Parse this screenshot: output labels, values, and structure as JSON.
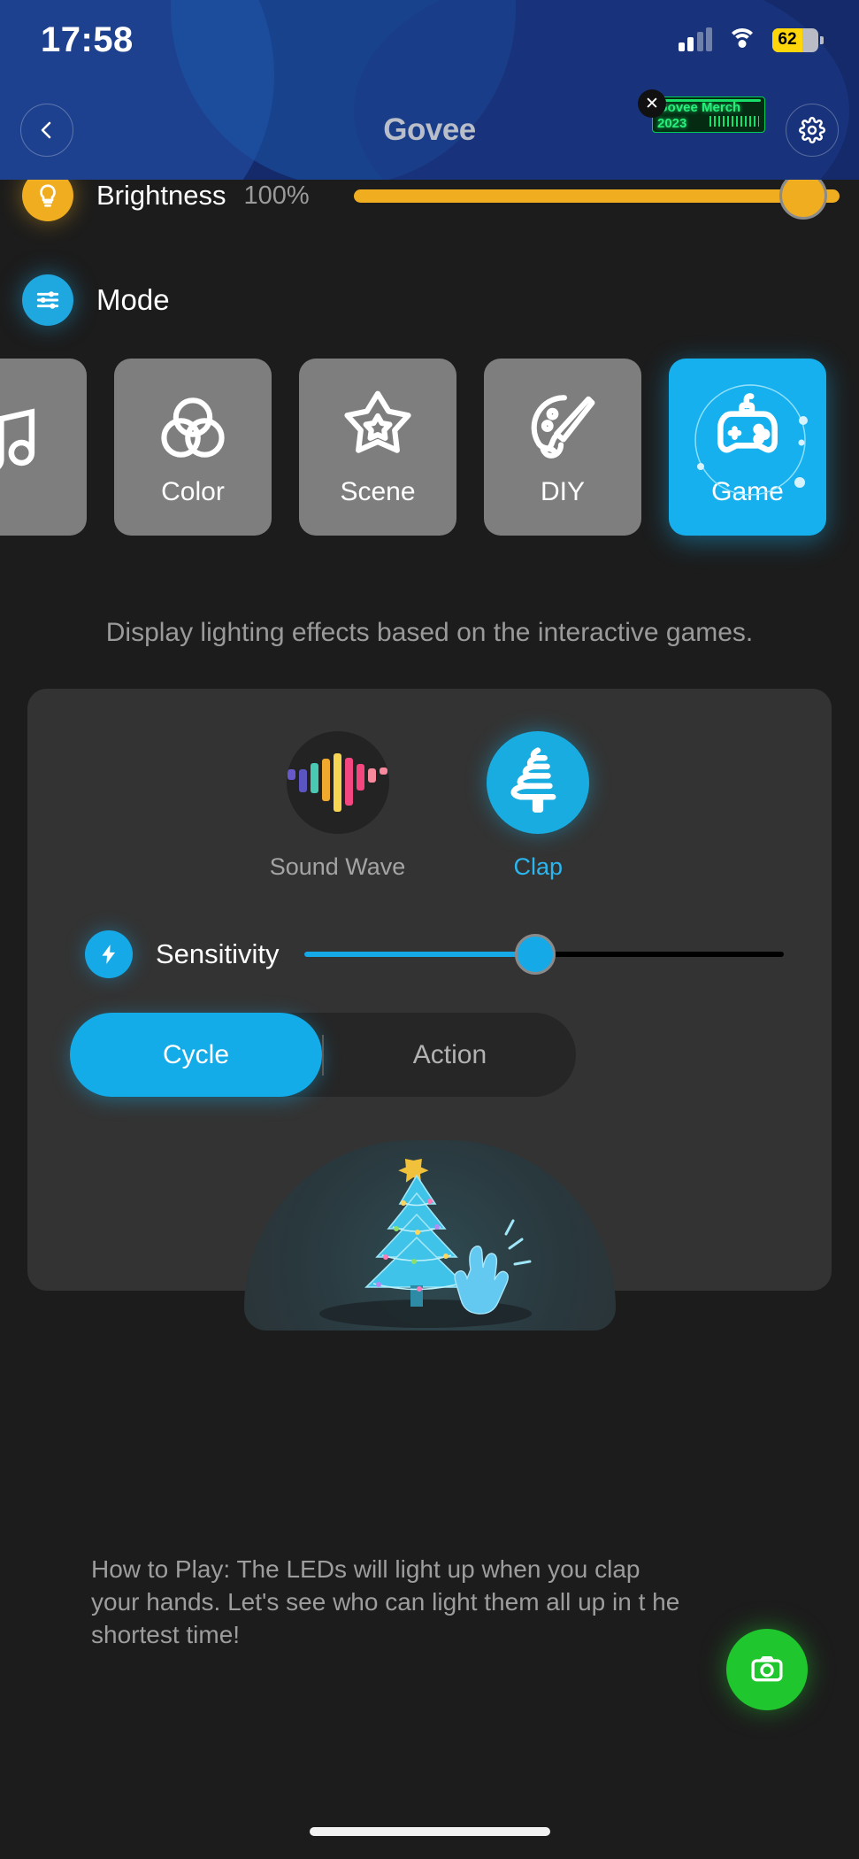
{
  "status_bar": {
    "time": "17:58",
    "battery_level": "62",
    "cellular_icon": "cellular-signal-icon",
    "wifi_icon": "wifi-icon",
    "battery_icon": "battery-icon"
  },
  "nav": {
    "back_icon": "chevron-left-icon",
    "brand": "Govee",
    "settings_icon": "gear-icon",
    "promo": {
      "line1": "Govee Merch",
      "line2": "2023",
      "close_label": "✕"
    }
  },
  "brightness": {
    "icon": "lightbulb-icon",
    "label": "Brightness",
    "value": "100%",
    "slider_percent": 100
  },
  "mode": {
    "icon": "sliders-icon",
    "label": "Mode",
    "tabs": [
      {
        "label": "",
        "icon": "music-note-icon",
        "active": false,
        "partial": true
      },
      {
        "label": "Color",
        "icon": "color-circles-icon",
        "active": false,
        "partial": false
      },
      {
        "label": "Scene",
        "icon": "star-badge-icon",
        "active": false,
        "partial": false
      },
      {
        "label": "DIY",
        "icon": "palette-brush-icon",
        "active": false,
        "partial": false
      },
      {
        "label": "Game",
        "icon": "gamepad-icon",
        "active": true,
        "partial": false
      }
    ],
    "description": "Display lighting effects based on the interactive games."
  },
  "game_panel": {
    "choices": [
      {
        "label": "Sound Wave",
        "icon": "equalizer-icon",
        "selected": false
      },
      {
        "label": "Clap",
        "icon": "christmas-tree-icon",
        "selected": true
      }
    ],
    "sensitivity": {
      "icon": "lightning-bolt-icon",
      "label": "Sensitivity",
      "percent": 48
    },
    "segments": [
      {
        "label": "Cycle",
        "selected": true
      },
      {
        "label": "Action",
        "selected": false
      }
    ],
    "illustration": {
      "name": "christmas-tree-clapping-hands-illustration"
    },
    "how_to_play": "How to Play: The LEDs will light up when you clap your hands. Let's see who can light them all up in t he shortest time!"
  },
  "fab": {
    "icon": "camera-icon",
    "color": "#1fc62e"
  },
  "colors": {
    "accent_blue": "#16b0ef",
    "brightness_orange": "#f0ad20",
    "panel_bg": "#333333",
    "page_bg": "#1c1c1c",
    "header_blue": "#152a6b",
    "fab_green": "#1fc62e"
  }
}
